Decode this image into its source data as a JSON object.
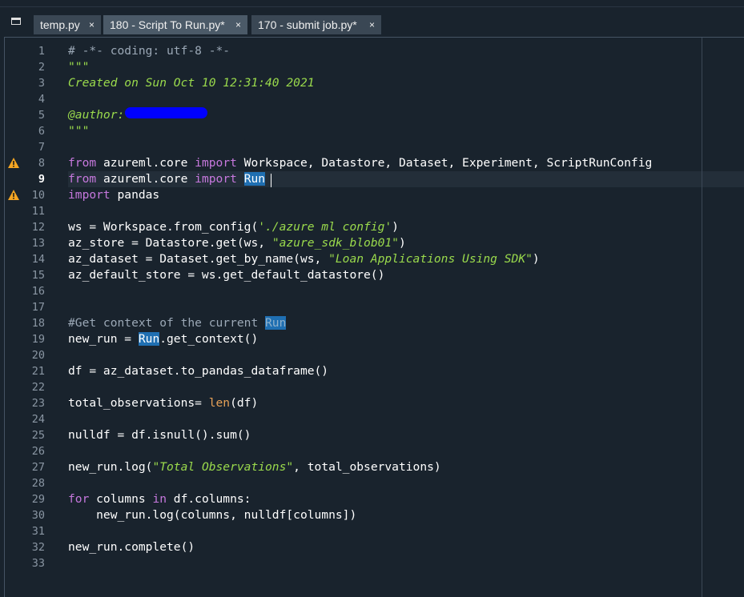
{
  "tabs": [
    {
      "label": "temp.py",
      "close": "×"
    },
    {
      "label": "180 - Script To Run.py*",
      "close": "×"
    },
    {
      "label": "170 - submit job.py*",
      "close": "×"
    }
  ],
  "gutter": {
    "line_numbers": [
      "1",
      "2",
      "3",
      "4",
      "5",
      "6",
      "7",
      "8",
      "9",
      "10",
      "11",
      "12",
      "13",
      "14",
      "15",
      "16",
      "17",
      "18",
      "19",
      "20",
      "21",
      "22",
      "23",
      "24",
      "25",
      "26",
      "27",
      "28",
      "29",
      "30",
      "31",
      "32",
      "33"
    ],
    "current_line": "9",
    "warning_lines": [
      "8",
      "10"
    ]
  },
  "code": {
    "l1": "# -*- coding: utf-8 -*-",
    "l2": "\"\"\"",
    "l3": "Created on Sun Oct 10 12:31:40 2021",
    "l5": "@author:",
    "l6": "\"\"\"",
    "l8": {
      "kw1": "from",
      "mod": " azureml.core ",
      "kw2": "import",
      "rest": " Workspace, Datastore, Dataset, Experiment, ScriptRunConfig"
    },
    "l9": {
      "kw1": "from",
      "mod": " azureml.core ",
      "kw2": "import",
      "sp": " ",
      "hl": "Run"
    },
    "l10": {
      "kw": "import",
      "rest": " pandas"
    },
    "l12": {
      "a": "ws = Workspace.from_config(",
      "s": "'./azure ml config'",
      "b": ")"
    },
    "l13": {
      "a": "az_store = Datastore.get(ws, ",
      "s": "\"azure_sdk_blob01\"",
      "b": ")"
    },
    "l14": {
      "a": "az_dataset = Dataset.get_by_name(ws, ",
      "s": "\"Loan Applications Using SDK\"",
      "b": ")"
    },
    "l15": "az_default_store = ws.get_default_datastore()",
    "l18": {
      "a": "#Get context of the current ",
      "hl": "Run"
    },
    "l19": {
      "a": "new_run = ",
      "hl": "Run",
      "b": ".get_context()"
    },
    "l21": "df = az_dataset.to_pandas_dataframe()",
    "l23": {
      "a": "total_observations= ",
      "bi": "len",
      "b": "(df)"
    },
    "l25": "nulldf = df.isnull().sum()",
    "l27": {
      "a": "new_run.log(",
      "s": "\"Total Observations\"",
      "b": ", total_observations)"
    },
    "l29": {
      "kw1": "for",
      "a": " columns ",
      "kw2": "in",
      "b": " df.columns:"
    },
    "l30": "    new_run.log(columns, nulldf[columns])",
    "l32": "new_run.complete()"
  },
  "colors": {
    "background": "#19232d",
    "keyword": "#c678dd",
    "string": "#9ada4c",
    "builtin": "#e6a157",
    "selection": "#1f6fb2",
    "warning": "#f5a623"
  },
  "icons": {
    "pane": "window-pane-icon",
    "warning": "warning-triangle-icon",
    "close": "close-icon"
  }
}
